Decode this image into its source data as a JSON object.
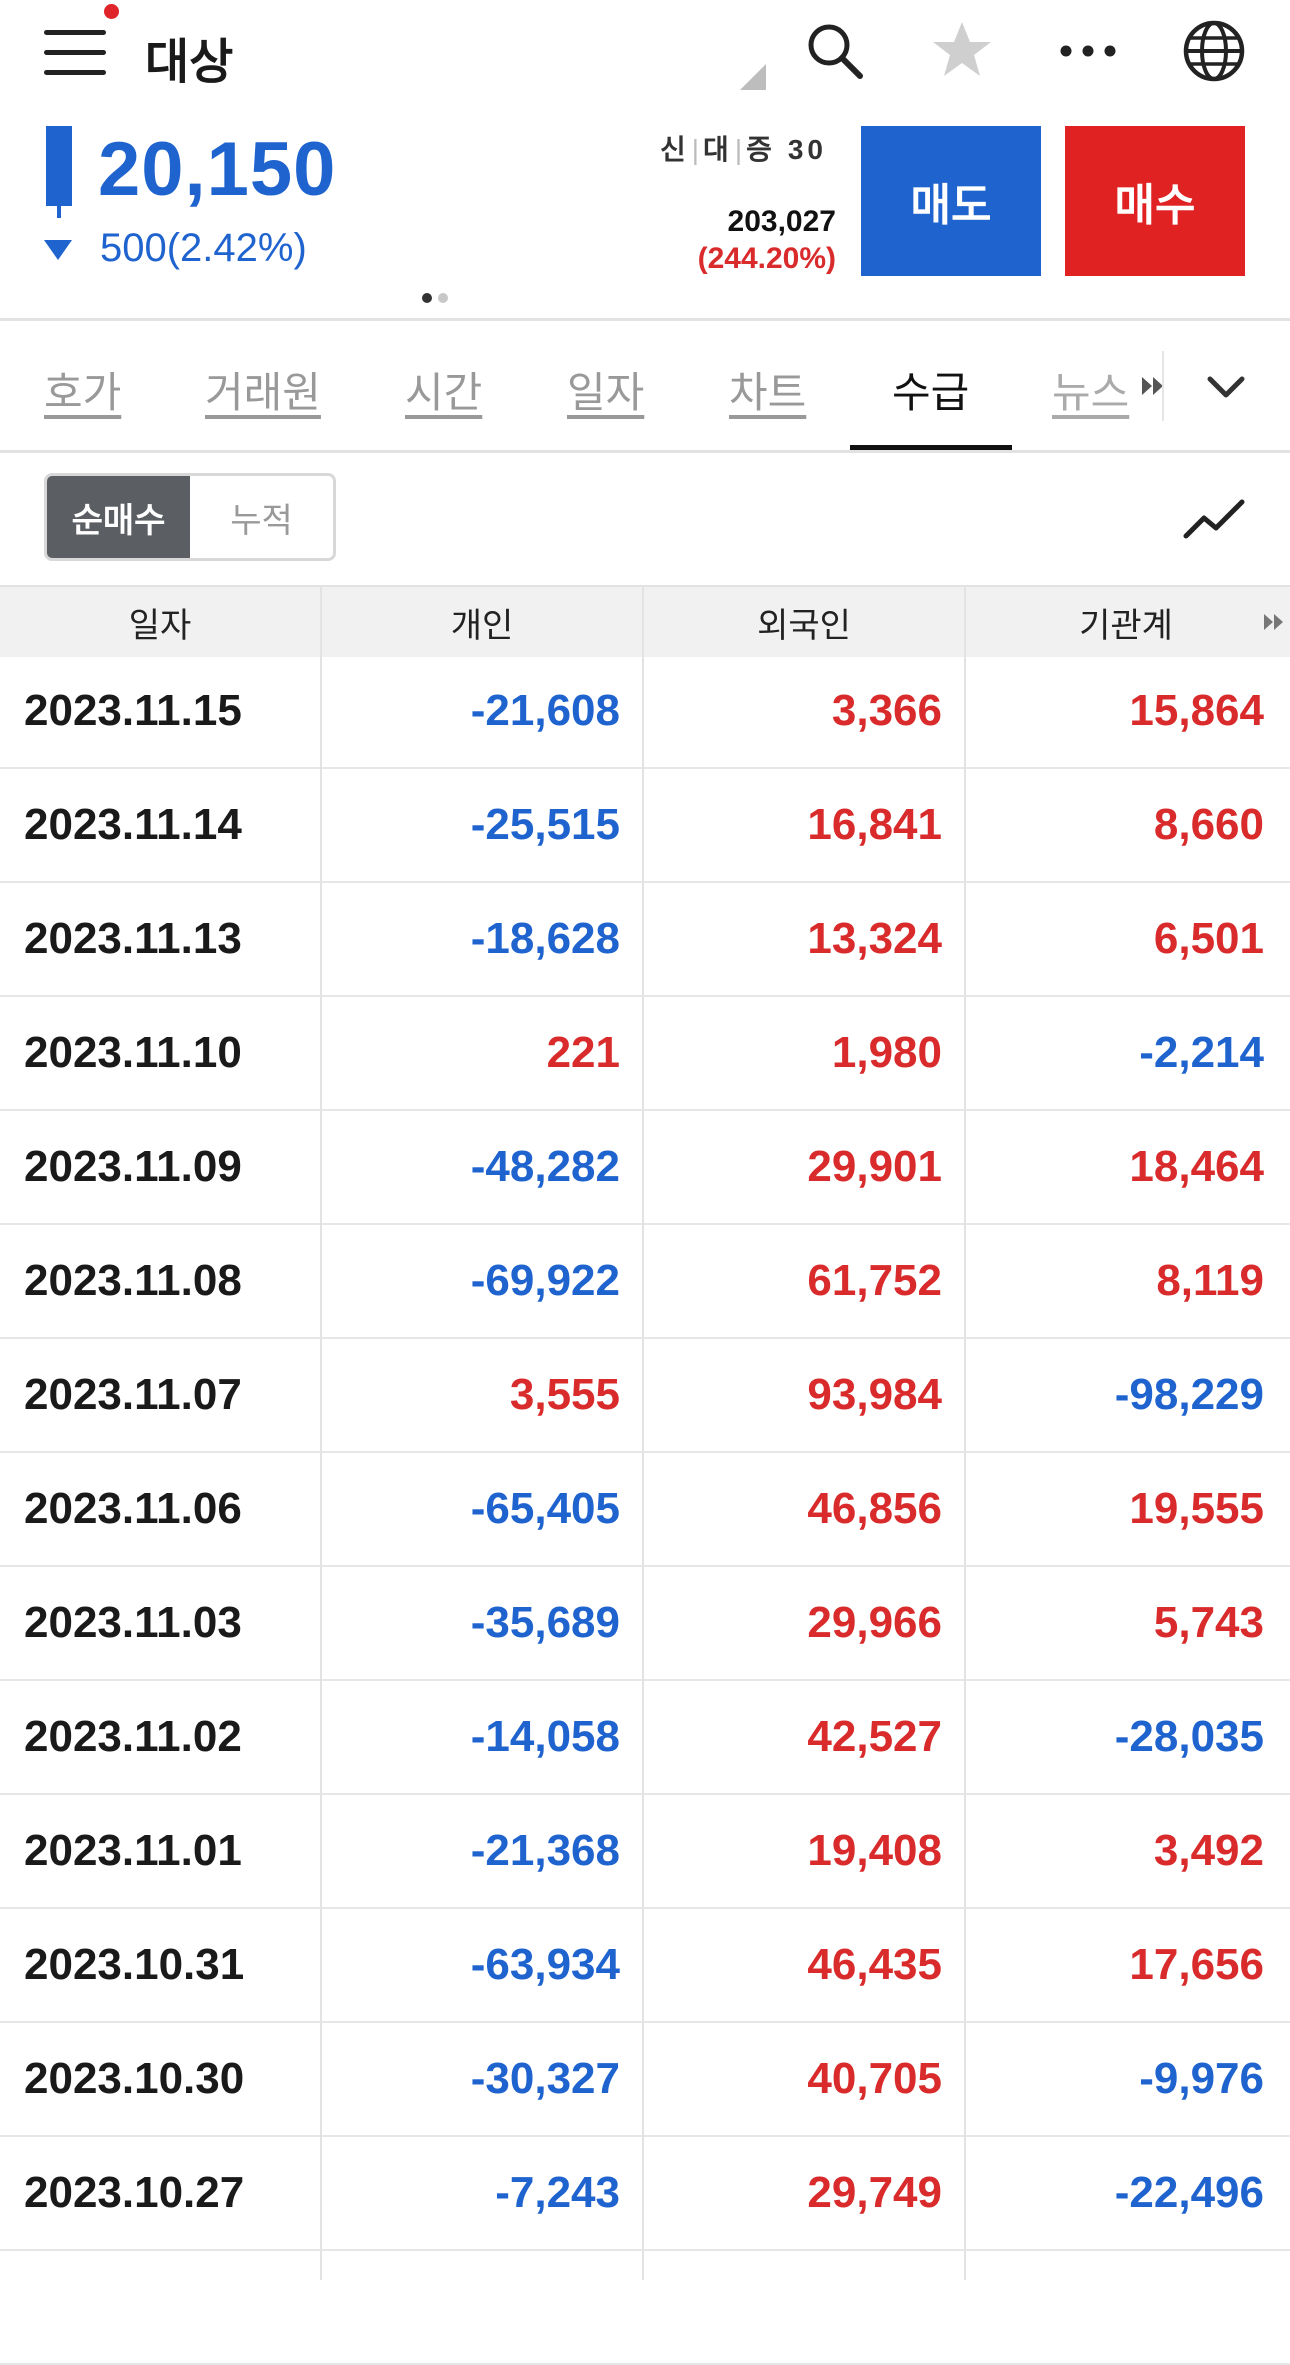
{
  "header": {
    "stock_name": "대상",
    "icons": [
      "menu-icon",
      "search-icon",
      "star-icon",
      "more-icon",
      "globe-icon"
    ]
  },
  "quote": {
    "price": "20,150",
    "change": "500(2.42%)",
    "credit_labels": [
      "신",
      "대",
      "증"
    ],
    "credit_value": "30",
    "volume": "203,027",
    "volume_rate": "(244.20%)",
    "sell_label": "매도",
    "buy_label": "매수",
    "pager_count": 2,
    "pager_active": 0
  },
  "tabs": {
    "items": [
      {
        "label": "호가"
      },
      {
        "label": "거래원"
      },
      {
        "label": "시간"
      },
      {
        "label": "일자"
      },
      {
        "label": "차트"
      },
      {
        "label": "수급"
      },
      {
        "label": "뉴스"
      }
    ],
    "active_index": 5
  },
  "toggle": {
    "options": [
      "순매수",
      "누적"
    ],
    "selected": "순매수"
  },
  "table": {
    "columns": [
      "일자",
      "개인",
      "외국인",
      "기관계"
    ],
    "rows": [
      {
        "date": "2023.11.15",
        "individual": "-21,608",
        "foreign": "3,366",
        "institution": "15,864"
      },
      {
        "date": "2023.11.14",
        "individual": "-25,515",
        "foreign": "16,841",
        "institution": "8,660"
      },
      {
        "date": "2023.11.13",
        "individual": "-18,628",
        "foreign": "13,324",
        "institution": "6,501"
      },
      {
        "date": "2023.11.10",
        "individual": "221",
        "foreign": "1,980",
        "institution": "-2,214"
      },
      {
        "date": "2023.11.09",
        "individual": "-48,282",
        "foreign": "29,901",
        "institution": "18,464"
      },
      {
        "date": "2023.11.08",
        "individual": "-69,922",
        "foreign": "61,752",
        "institution": "8,119"
      },
      {
        "date": "2023.11.07",
        "individual": "3,555",
        "foreign": "93,984",
        "institution": "-98,229"
      },
      {
        "date": "2023.11.06",
        "individual": "-65,405",
        "foreign": "46,856",
        "institution": "19,555"
      },
      {
        "date": "2023.11.03",
        "individual": "-35,689",
        "foreign": "29,966",
        "institution": "5,743"
      },
      {
        "date": "2023.11.02",
        "individual": "-14,058",
        "foreign": "42,527",
        "institution": "-28,035"
      },
      {
        "date": "2023.11.01",
        "individual": "-21,368",
        "foreign": "19,408",
        "institution": "3,492"
      },
      {
        "date": "2023.10.31",
        "individual": "-63,934",
        "foreign": "46,435",
        "institution": "17,656"
      },
      {
        "date": "2023.10.30",
        "individual": "-30,327",
        "foreign": "40,705",
        "institution": "-9,976"
      },
      {
        "date": "2023.10.27",
        "individual": "-7,243",
        "foreign": "29,749",
        "institution": "-22,496"
      },
      {
        "date": "",
        "individual": "",
        "foreign": "",
        "institution": ""
      }
    ]
  },
  "colors": {
    "down_blue": "#1f63cf",
    "up_red": "#d92b2b",
    "sell_blue": "#1f63cf",
    "buy_red": "#e02222"
  }
}
